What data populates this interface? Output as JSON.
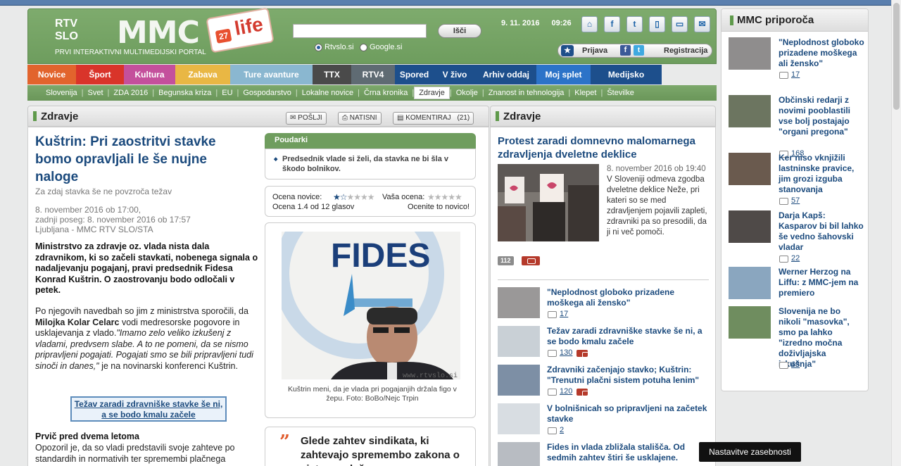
{
  "header": {
    "rtv": "RTV",
    "slo": "SLO",
    "mmc": "MMC",
    "subtitle": "PRVI INTERAKTIVNI MULTIMEDIJSKI PORTAL",
    "life_num": "27",
    "life_word": "life",
    "search_button": "Išči",
    "radio_rtv": "Rtvslo.si",
    "radio_google": "Google.si",
    "date": "9. 11. 2016",
    "time": "09:26",
    "login": "Prijava",
    "register": "Registracija"
  },
  "nav": [
    {
      "label": "Novice",
      "color": "#e2642d",
      "w": 69
    },
    {
      "label": "Šport",
      "color": "#d9342a",
      "w": 68
    },
    {
      "label": "Kultura",
      "color": "#c4509c",
      "w": 73
    },
    {
      "label": "Zabava",
      "color": "#e9b744",
      "w": 78
    },
    {
      "label": "Ture avanture",
      "color": "#8ab7d0",
      "w": 117
    },
    {
      "label": "TTX",
      "color": "#4a4a4a",
      "w": 55
    },
    {
      "label": "RTV4",
      "color": "#5f6b73",
      "w": 62
    },
    {
      "label": "Spored",
      "color": "#1d4f8c",
      "w": 55
    },
    {
      "label": "V živo",
      "color": "#1d4f8c",
      "w": 60
    },
    {
      "label": "Arhiv oddaj",
      "color": "#1d4f8c",
      "w": 86
    },
    {
      "label": "Moj splet",
      "color": "#2c73c8",
      "w": 77
    },
    {
      "label": "Medijsko središče",
      "color": "#1d4f8c",
      "w": 101
    }
  ],
  "subnav": [
    "Slovenija",
    "Svet",
    "ZDA 2016",
    "Begunska kriza",
    "EU",
    "Gospodarstvo",
    "Lokalne novice",
    "Črna kronika",
    "Zdravje",
    "Okolje",
    "Znanost in tehnologija",
    "Klepet",
    "Številke"
  ],
  "subnav_active": "Zdravje",
  "article": {
    "section": "Zdravje",
    "btn_send": "POŠLJI",
    "btn_print": "NATISNI",
    "btn_comment": "KOMENTIRAJ",
    "comment_count": "(21)",
    "title": "Kuštrin: Pri zaostritvi stavke bomo opravljali le še nujne naloge",
    "subtitle": "Za zdaj stavka še ne povzroča težav",
    "date": "8. november 2016 ob 17:00,",
    "updated": "zadnji poseg: 8. november 2016 ob 17:57",
    "source": "Ljubljana - MMC RTV SLO/STA",
    "lead": "Ministrstvo za zdravje oz. vlada nista dala zdravnikom, ki so začeli stavkati, nobenega signala o nadaljevanju pogajanj, pravi predsednik Fidesa Konrad Kuštrin. O zaostrovanju bodo odločali v petek.",
    "body_1": "Po njegovih navedbah so jim z ministrstva sporočili, da",
    "body_name": "Milojka Kolar Celarc",
    "body_2": "vodi medresorske pogovore in usklajevanja z vlado.",
    "body_quote": "\"Imamo zelo veliko izkušenj z vladami, predvsem slabe. A to ne pomeni, da se nismo pripravljeni pogajati. Pogajati smo se bili pripravljeni tudi sinoči in danes,\"",
    "body_3": "je na novinarski konferenci Kuštrin.",
    "related": "Težav zaradi zdravniške stavke še ni, a se bodo kmalu začele",
    "section_head": "Prvič pred dvema letoma",
    "section_text": "Opozoril je, da so vladi predstavili svoje zahteve po standardih in normativih ter spremembi plačnega",
    "highlights_title": "Poudarki",
    "highlight_1": "Predsednik vlade si želi, da stavka ne bi šla v škodo bolnikov.",
    "rating_label": "Ocena novice:",
    "rating_value": "Ocena 1.4 od 12 glasov",
    "your_rating": "Vaša ocena:",
    "rate_cta": "Ocenite to novico!",
    "rating_stars": 1.4,
    "photo_watermark": "www.rtvslo.si",
    "photo_letters": "FIDES",
    "photo_caption": "Kuštrin meni, da je vlada pri pogajanjih držala figo v žepu. Foto: BoBo/Nejc Trpin",
    "pullquote": "Glede zahtev sindikata, ki zahtevajo spremembo zakona o sistemu plač v"
  },
  "middle": {
    "section": "Zdravje",
    "top_title": "Protest zaradi domnevno malomarnega zdravljenja dveletne deklice",
    "top_date": "8. november 2016 ob 19:40",
    "top_text": "V Sloveniji odmeva zgodba dveletne deklice Neže, pri kateri so se med zdravljenjem pojavili zapleti, zdravniki pa so presodili, da ji ni več pomoči.",
    "top_count": "112",
    "items": [
      {
        "title": "\"Neplodnost globoko prizadene moškega ali žensko\"",
        "count": "17",
        "tv": false
      },
      {
        "title": "Težav zaradi zdravniške stavke še ni, a se bodo kmalu začele",
        "count": "130",
        "tv": true
      },
      {
        "title": "Zdravniki začenjajo stavko; Kuštrin: \"Trenutni plačni sistem potuha lenim\"",
        "count": "120",
        "tv": true
      },
      {
        "title": "V bolnišnicah so pripravljeni na začetek stavke",
        "count": "2",
        "tv": false
      },
      {
        "title": "Fides in vlada zbližala stališča. Od sedmih zahtev štiri še usklajene.",
        "count": "",
        "tv": false
      }
    ]
  },
  "right": {
    "title": "MMC priporoča",
    "items": [
      {
        "title": "\"Neplodnost globoko prizadene moškega ali žensko\"",
        "count": "17"
      },
      {
        "title": "Občinski redarji z novimi pooblastili vse bolj postajajo \"organi pregona\"",
        "count": "168"
      },
      {
        "title": "Ker niso vknjižili lastninske pravice, jim grozi izguba stanovanja",
        "count": "57"
      },
      {
        "title": "Darja Kapš: Kasparov bi bil lahko še vedno šahovski vladar",
        "count": "22"
      },
      {
        "title": "Werner Herzog na Liffu: z MMC-jem na premiero",
        "count": ""
      },
      {
        "title": "Slovenija ne bo nikoli \"masovka\", smo pa lahko \"izredno močna doživljajska izkušnja\"",
        "count": "63"
      }
    ]
  },
  "tooltip": "Nastavitve zasebnosti"
}
